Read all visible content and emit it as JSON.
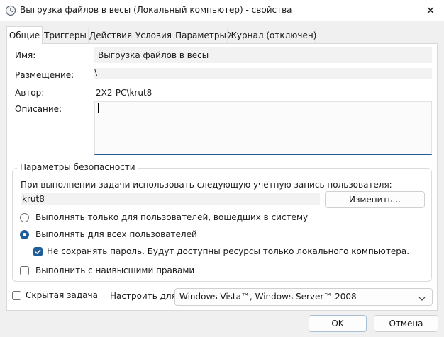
{
  "window": {
    "title": "Выгрузка файлов в весы (Локальный компьютер) - свойства",
    "app_icon": "task-scheduler-clock-icon",
    "close_icon": "close-icon",
    "close_glyph": "✕"
  },
  "tabs": [
    {
      "label": "Общие",
      "active": true
    },
    {
      "label": "Триггеры",
      "active": false
    },
    {
      "label": "Действия",
      "active": false
    },
    {
      "label": "Условия",
      "active": false
    },
    {
      "label": "Параметры",
      "active": false
    },
    {
      "label": "Журнал (отключен)",
      "active": false
    }
  ],
  "general": {
    "name_label": "Имя:",
    "name_value": "Выгрузка файлов в весы",
    "location_label": "Размещение:",
    "location_value": "\\",
    "author_label": "Автор:",
    "author_value": "2X2-PC\\krut8",
    "description_label": "Описание:",
    "description_value": ""
  },
  "security": {
    "legend": "Параметры безопасности",
    "account_prompt": "При выполнении задачи использовать следующую учетную запись пользователя:",
    "account_value": "krut8",
    "change_button": "Изменить...",
    "radio_logged_on": "Выполнять только для пользователей, вошедших в систему",
    "radio_all_users": "Выполнять для всех пользователей",
    "selected_radio": "all_users",
    "no_store_password": "Не сохранять пароль. Будут доступны ресурсы только локального компьютера.",
    "no_store_password_checked": true,
    "highest_privileges": "Выполнить с наивысшими правами",
    "highest_privileges_checked": false
  },
  "footer": {
    "hidden_task": "Скрытая задача",
    "hidden_task_checked": false,
    "configure_for_label": "Настроить для:",
    "configure_for_value": "Windows Vista™, Windows Server™ 2008",
    "ok_button": "OK",
    "cancel_button": "Отмена"
  },
  "colors": {
    "accent": "#1f5d98",
    "window_bg": "#f0f0f0",
    "panel_bg": "#ffffff",
    "readonly_field": "#f2f2f2"
  }
}
